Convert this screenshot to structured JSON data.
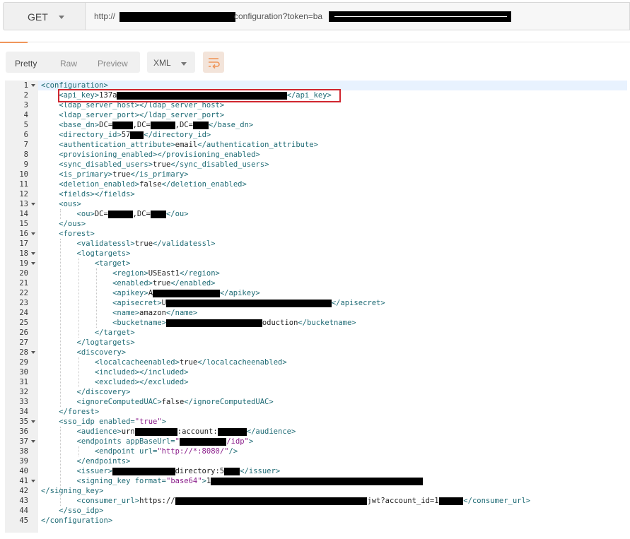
{
  "request": {
    "method": "GET",
    "url_prefix": "http://",
    "url_suffix": "configuration?token=ba"
  },
  "colors": {
    "accent": "#f0965a",
    "highlight_box": "#d0262f",
    "tag": "#1f6b75",
    "string": "#8b1e8b"
  },
  "response_toolbar": {
    "views": [
      "Pretty",
      "Raw",
      "Preview"
    ],
    "active_view": "Pretty",
    "format": "XML",
    "wrap_icon": "wrap-lines-icon"
  },
  "code": {
    "lines": [
      [
        {
          "c": "t",
          "v": "<configuration>"
        }
      ],
      [
        {
          "c": "t",
          "v": "<api_key>"
        },
        {
          "c": "",
          "v": "137a"
        },
        {
          "c": "t",
          "v": "</api_key>"
        }
      ],
      [
        {
          "c": "t",
          "v": "<ldap_server_host></ldap_server_host>"
        }
      ],
      [
        {
          "c": "t",
          "v": "<ldap_server_port></ldap_server_port>"
        }
      ],
      [
        {
          "c": "t",
          "v": "<base_dn>"
        },
        {
          "c": "",
          "v": "DC="
        },
        {
          "c": "",
          "v": ",DC="
        },
        {
          "c": "",
          "v": ",DC="
        },
        {
          "c": "t",
          "v": "</base_dn>"
        }
      ],
      [
        {
          "c": "t",
          "v": "<directory_id>"
        },
        {
          "c": "",
          "v": "57"
        },
        {
          "c": "t",
          "v": "</directory_id>"
        }
      ],
      [
        {
          "c": "t",
          "v": "<authentication_attribute>"
        },
        {
          "c": "",
          "v": "email"
        },
        {
          "c": "t",
          "v": "</authentication_attribute>"
        }
      ],
      [
        {
          "c": "t",
          "v": "<provisioning_enabled></provisioning_enabled>"
        }
      ],
      [
        {
          "c": "t",
          "v": "<sync_disabled_users>"
        },
        {
          "c": "",
          "v": "true"
        },
        {
          "c": "t",
          "v": "</sync_disabled_users>"
        }
      ],
      [
        {
          "c": "t",
          "v": "<is_primary>"
        },
        {
          "c": "",
          "v": "true"
        },
        {
          "c": "t",
          "v": "</is_primary>"
        }
      ],
      [
        {
          "c": "t",
          "v": "<deletion_enabled>"
        },
        {
          "c": "",
          "v": "false"
        },
        {
          "c": "t",
          "v": "</deletion_enabled>"
        }
      ],
      [
        {
          "c": "t",
          "v": "<fields></fields>"
        }
      ],
      [
        {
          "c": "t",
          "v": "<ous>"
        }
      ],
      [
        {
          "c": "t",
          "v": "<ou>"
        },
        {
          "c": "",
          "v": "DC="
        },
        {
          "c": "",
          "v": ",DC="
        },
        {
          "c": "t",
          "v": "</ou>"
        }
      ],
      [
        {
          "c": "t",
          "v": "</ous>"
        }
      ],
      [
        {
          "c": "t",
          "v": "<forest>"
        }
      ],
      [
        {
          "c": "t",
          "v": "<validatessl>"
        },
        {
          "c": "",
          "v": "true"
        },
        {
          "c": "t",
          "v": "</validatessl>"
        }
      ],
      [
        {
          "c": "t",
          "v": "<logtargets>"
        }
      ],
      [
        {
          "c": "t",
          "v": "<target>"
        }
      ],
      [
        {
          "c": "t",
          "v": "<region>"
        },
        {
          "c": "",
          "v": "USEast1"
        },
        {
          "c": "t",
          "v": "</region>"
        }
      ],
      [
        {
          "c": "t",
          "v": "<enabled>"
        },
        {
          "c": "",
          "v": "true"
        },
        {
          "c": "t",
          "v": "</enabled>"
        }
      ],
      [
        {
          "c": "t",
          "v": "<apikey>"
        },
        {
          "c": "",
          "v": "A"
        },
        {
          "c": "t",
          "v": "</apikey>"
        }
      ],
      [
        {
          "c": "t",
          "v": "<apisecret>"
        },
        {
          "c": "",
          "v": "U"
        },
        {
          "c": "t",
          "v": "</apisecret>"
        }
      ],
      [
        {
          "c": "t",
          "v": "<name>"
        },
        {
          "c": "",
          "v": "amazon"
        },
        {
          "c": "t",
          "v": "</name>"
        }
      ],
      [
        {
          "c": "t",
          "v": "<bucketname>"
        },
        {
          "c": "",
          "v": "oduction"
        },
        {
          "c": "t",
          "v": "</bucketname>"
        }
      ],
      [
        {
          "c": "t",
          "v": "</target>"
        }
      ],
      [
        {
          "c": "t",
          "v": "</logtargets>"
        }
      ],
      [
        {
          "c": "t",
          "v": "<discovery>"
        }
      ],
      [
        {
          "c": "t",
          "v": "<localcacheenabled>"
        },
        {
          "c": "",
          "v": "true"
        },
        {
          "c": "t",
          "v": "</localcacheenabled>"
        }
      ],
      [
        {
          "c": "t",
          "v": "<included></included>"
        }
      ],
      [
        {
          "c": "t",
          "v": "<excluded></excluded>"
        }
      ],
      [
        {
          "c": "t",
          "v": "</discovery>"
        }
      ],
      [
        {
          "c": "t",
          "v": "<ignoreComputedUAC>"
        },
        {
          "c": "",
          "v": "false"
        },
        {
          "c": "t",
          "v": "</ignoreComputedUAC>"
        }
      ],
      [
        {
          "c": "t",
          "v": "</forest>"
        }
      ],
      [
        {
          "c": "t",
          "v": "<sso_idp "
        },
        {
          "c": "a",
          "v": "enabled="
        },
        {
          "c": "s",
          "v": "\"true\""
        },
        {
          "c": "t",
          "v": ">"
        }
      ],
      [
        {
          "c": "t",
          "v": "<audience>"
        },
        {
          "c": "",
          "v": "urn"
        },
        {
          "c": "",
          "v": ":account:"
        },
        {
          "c": "t",
          "v": "</audience>"
        }
      ],
      [
        {
          "c": "t",
          "v": "<endpoints "
        },
        {
          "c": "a",
          "v": "appBaseUrl="
        },
        {
          "c": "s",
          "v": "\""
        },
        {
          "c": "s",
          "v": "/idp\""
        },
        {
          "c": "t",
          "v": ">"
        }
      ],
      [
        {
          "c": "t",
          "v": "<endpoint "
        },
        {
          "c": "a",
          "v": "url="
        },
        {
          "c": "s",
          "v": "\"http://*:8080/\""
        },
        {
          "c": "t",
          "v": "/>"
        }
      ],
      [
        {
          "c": "t",
          "v": "</endpoints>"
        }
      ],
      [
        {
          "c": "t",
          "v": "<issuer>"
        },
        {
          "c": "",
          "v": "directory:5"
        },
        {
          "c": "t",
          "v": "</issuer>"
        }
      ],
      [
        {
          "c": "t",
          "v": "<signing_key "
        },
        {
          "c": "a",
          "v": "format="
        },
        {
          "c": "s",
          "v": "\"base64\""
        },
        {
          "c": "t",
          "v": ">"
        },
        {
          "c": "",
          "v": "1"
        }
      ],
      [
        {
          "c": "t",
          "v": "</signing_key>"
        }
      ],
      [
        {
          "c": "t",
          "v": "<consumer_url>"
        },
        {
          "c": "",
          "v": "https://"
        },
        {
          "c": "",
          "v": "jwt?account_id=1"
        },
        {
          "c": "t",
          "v": "</consumer_url>"
        }
      ],
      [
        {
          "c": "t",
          "v": "</sso_idp>"
        }
      ],
      [
        {
          "c": "t",
          "v": "</configuration>"
        }
      ]
    ]
  }
}
